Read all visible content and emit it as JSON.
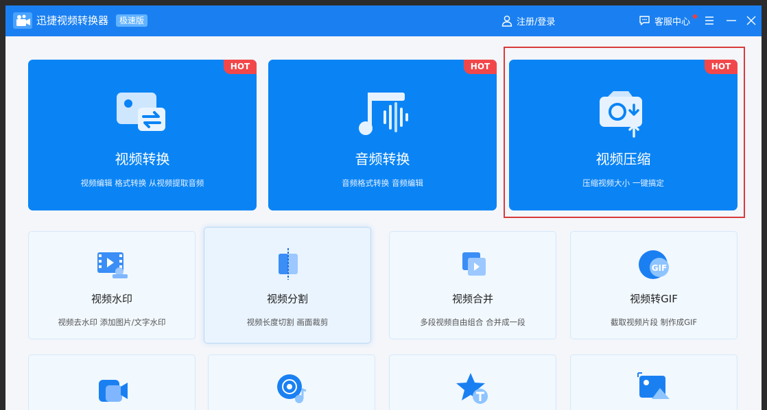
{
  "titlebar": {
    "app_title": "迅捷视频转换器",
    "edition_badge": "极速版",
    "login_label": "注册/登录",
    "service_label": "客服中心"
  },
  "big_cards": [
    {
      "name": "视频转换",
      "desc": "视频编辑 格式转换 从视频提取音频",
      "hot": "HOT"
    },
    {
      "name": "音频转换",
      "desc": "音频格式转换 音频编辑",
      "hot": "HOT"
    },
    {
      "name": "视频压缩",
      "desc": "压缩视频大小 一键搞定",
      "hot": "HOT"
    }
  ],
  "tool_cards": [
    {
      "name": "视频水印",
      "desc": "视频去水印 添加图片/文字水印"
    },
    {
      "name": "视频分割",
      "desc": "视频长度切割 画面裁剪"
    },
    {
      "name": "视频合并",
      "desc": "多段视频自由组合 合并成一段"
    },
    {
      "name": "视频转GIF",
      "desc": "截取视频片段 制作成GIF"
    }
  ],
  "colors": {
    "titlebar": "#1a80f2",
    "card": "#0a84f5",
    "hot": "#f2474a",
    "highlight": "#d93a3a"
  }
}
